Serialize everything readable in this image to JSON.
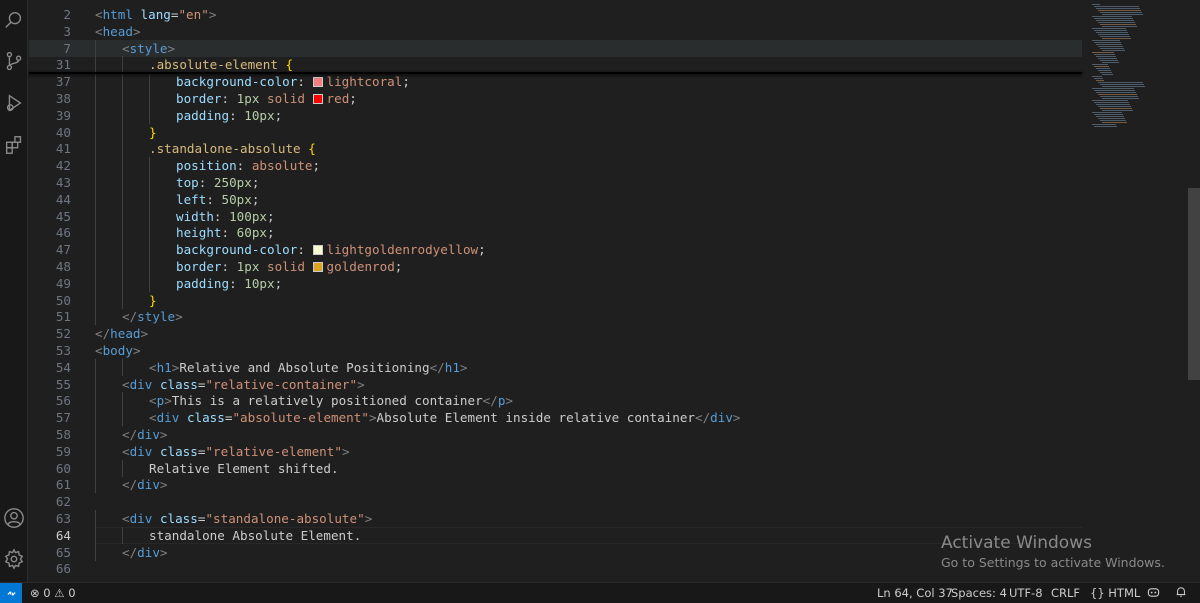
{
  "editor": {
    "lines": [
      {
        "num": "2",
        "indent": 0,
        "tokens": [
          [
            "t",
            "<"
          ],
          [
            "tg",
            "html"
          ],
          [
            "tx",
            " "
          ],
          [
            "at",
            "lang"
          ],
          [
            "tx",
            "="
          ],
          [
            "st",
            "\"en\""
          ],
          [
            "t",
            ">"
          ]
        ]
      },
      {
        "num": "3",
        "indent": 0,
        "tokens": [
          [
            "t",
            "<"
          ],
          [
            "tg",
            "head"
          ],
          [
            "t",
            ">"
          ]
        ]
      },
      {
        "num": "7",
        "indent": 1,
        "tokens": [
          [
            "t",
            "<"
          ],
          [
            "tg",
            "style"
          ],
          [
            "t",
            ">"
          ]
        ]
      },
      {
        "num": "31",
        "indent": 2,
        "tokens": [
          [
            "sel",
            ".absolute-element"
          ],
          [
            "tx",
            " "
          ],
          [
            "br",
            "{"
          ]
        ]
      },
      {
        "num": "37",
        "indent": 3,
        "tokens": [
          [
            "pr",
            "background-color"
          ],
          [
            "tx",
            ": "
          ],
          [
            "sw",
            "#f08080"
          ],
          [
            "vl",
            "lightcoral"
          ],
          [
            "tx",
            ";"
          ]
        ]
      },
      {
        "num": "38",
        "indent": 3,
        "tokens": [
          [
            "pr",
            "border"
          ],
          [
            "tx",
            ": "
          ],
          [
            "nm",
            "1px"
          ],
          [
            "tx",
            " "
          ],
          [
            "vl",
            "solid"
          ],
          [
            "tx",
            " "
          ],
          [
            "sw",
            "#ff0000"
          ],
          [
            "vl",
            "red"
          ],
          [
            "tx",
            ";"
          ]
        ]
      },
      {
        "num": "39",
        "indent": 3,
        "tokens": [
          [
            "pr",
            "padding"
          ],
          [
            "tx",
            ": "
          ],
          [
            "nm",
            "10px"
          ],
          [
            "tx",
            ";"
          ]
        ]
      },
      {
        "num": "40",
        "indent": 2,
        "tokens": [
          [
            "br",
            "}"
          ]
        ]
      },
      {
        "num": "41",
        "indent": 2,
        "tokens": [
          [
            "sel",
            ".standalone-absolute"
          ],
          [
            "tx",
            " "
          ],
          [
            "br",
            "{"
          ]
        ]
      },
      {
        "num": "42",
        "indent": 3,
        "tokens": [
          [
            "pr",
            "position"
          ],
          [
            "tx",
            ": "
          ],
          [
            "vl",
            "absolute"
          ],
          [
            "tx",
            ";"
          ]
        ]
      },
      {
        "num": "43",
        "indent": 3,
        "tokens": [
          [
            "pr",
            "top"
          ],
          [
            "tx",
            ": "
          ],
          [
            "nm",
            "250px"
          ],
          [
            "tx",
            ";"
          ]
        ]
      },
      {
        "num": "44",
        "indent": 3,
        "tokens": [
          [
            "pr",
            "left"
          ],
          [
            "tx",
            ": "
          ],
          [
            "nm",
            "50px"
          ],
          [
            "tx",
            ";"
          ]
        ]
      },
      {
        "num": "45",
        "indent": 3,
        "tokens": [
          [
            "pr",
            "width"
          ],
          [
            "tx",
            ": "
          ],
          [
            "nm",
            "100px"
          ],
          [
            "tx",
            ";"
          ]
        ]
      },
      {
        "num": "46",
        "indent": 3,
        "tokens": [
          [
            "pr",
            "height"
          ],
          [
            "tx",
            ": "
          ],
          [
            "nm",
            "60px"
          ],
          [
            "tx",
            ";"
          ]
        ]
      },
      {
        "num": "47",
        "indent": 3,
        "tokens": [
          [
            "pr",
            "background-color"
          ],
          [
            "tx",
            ": "
          ],
          [
            "sw",
            "#fafad2"
          ],
          [
            "vl",
            "lightgoldenrodyellow"
          ],
          [
            "tx",
            ";"
          ]
        ]
      },
      {
        "num": "48",
        "indent": 3,
        "tokens": [
          [
            "pr",
            "border"
          ],
          [
            "tx",
            ": "
          ],
          [
            "nm",
            "1px"
          ],
          [
            "tx",
            " "
          ],
          [
            "vl",
            "solid"
          ],
          [
            "tx",
            " "
          ],
          [
            "sw",
            "#daa520"
          ],
          [
            "vl",
            "goldenrod"
          ],
          [
            "tx",
            ";"
          ]
        ]
      },
      {
        "num": "49",
        "indent": 3,
        "tokens": [
          [
            "pr",
            "padding"
          ],
          [
            "tx",
            ": "
          ],
          [
            "nm",
            "10px"
          ],
          [
            "tx",
            ";"
          ]
        ]
      },
      {
        "num": "50",
        "indent": 2,
        "tokens": [
          [
            "br",
            "}"
          ]
        ]
      },
      {
        "num": "51",
        "indent": 1,
        "tokens": [
          [
            "t",
            "</"
          ],
          [
            "tg",
            "style"
          ],
          [
            "t",
            ">"
          ]
        ]
      },
      {
        "num": "52",
        "indent": 0,
        "tokens": [
          [
            "t",
            "</"
          ],
          [
            "tg",
            "head"
          ],
          [
            "t",
            ">"
          ]
        ]
      },
      {
        "num": "53",
        "indent": 0,
        "tokens": [
          [
            "t",
            "<"
          ],
          [
            "tg",
            "body"
          ],
          [
            "t",
            ">"
          ]
        ]
      },
      {
        "num": "54",
        "indent": 2,
        "tokens": [
          [
            "t",
            "<"
          ],
          [
            "tg",
            "h1"
          ],
          [
            "t",
            ">"
          ],
          [
            "tx",
            "Relative and Absolute Positioning"
          ],
          [
            "t",
            "</"
          ],
          [
            "tg",
            "h1"
          ],
          [
            "t",
            ">"
          ]
        ]
      },
      {
        "num": "55",
        "indent": 1,
        "tokens": [
          [
            "t",
            "<"
          ],
          [
            "tg",
            "div"
          ],
          [
            "tx",
            " "
          ],
          [
            "at",
            "class"
          ],
          [
            "tx",
            "="
          ],
          [
            "st",
            "\"relative-container\""
          ],
          [
            "t",
            ">"
          ]
        ]
      },
      {
        "num": "56",
        "indent": 2,
        "tokens": [
          [
            "t",
            "<"
          ],
          [
            "tg",
            "p"
          ],
          [
            "t",
            ">"
          ],
          [
            "tx",
            "This is a relatively positioned container"
          ],
          [
            "t",
            "</"
          ],
          [
            "tg",
            "p"
          ],
          [
            "t",
            ">"
          ]
        ]
      },
      {
        "num": "57",
        "indent": 2,
        "tokens": [
          [
            "t",
            "<"
          ],
          [
            "tg",
            "div"
          ],
          [
            "tx",
            " "
          ],
          [
            "at",
            "class"
          ],
          [
            "tx",
            "="
          ],
          [
            "st",
            "\"absolute-element\""
          ],
          [
            "t",
            ">"
          ],
          [
            "tx",
            "Absolute Element inside relative container"
          ],
          [
            "t",
            "</"
          ],
          [
            "tg",
            "div"
          ],
          [
            "t",
            ">"
          ]
        ]
      },
      {
        "num": "58",
        "indent": 1,
        "tokens": [
          [
            "t",
            "</"
          ],
          [
            "tg",
            "div"
          ],
          [
            "t",
            ">"
          ]
        ]
      },
      {
        "num": "59",
        "indent": 1,
        "tokens": [
          [
            "t",
            "<"
          ],
          [
            "tg",
            "div"
          ],
          [
            "tx",
            " "
          ],
          [
            "at",
            "class"
          ],
          [
            "tx",
            "="
          ],
          [
            "st",
            "\"relative-element\""
          ],
          [
            "t",
            ">"
          ]
        ]
      },
      {
        "num": "60",
        "indent": 2,
        "tokens": [
          [
            "tx",
            "Relative Element shifted."
          ]
        ]
      },
      {
        "num": "61",
        "indent": 1,
        "tokens": [
          [
            "t",
            "</"
          ],
          [
            "tg",
            "div"
          ],
          [
            "t",
            ">"
          ]
        ]
      },
      {
        "num": "62",
        "indent": 0,
        "tokens": []
      },
      {
        "num": "63",
        "indent": 1,
        "tokens": [
          [
            "t",
            "<"
          ],
          [
            "tg",
            "div"
          ],
          [
            "tx",
            " "
          ],
          [
            "at",
            "class"
          ],
          [
            "tx",
            "="
          ],
          [
            "st",
            "\"standalone-absolute\""
          ],
          [
            "t",
            ">"
          ]
        ]
      },
      {
        "num": "64",
        "indent": 2,
        "tokens": [
          [
            "tx",
            "standalone Absolute Element."
          ]
        ]
      },
      {
        "num": "65",
        "indent": 1,
        "tokens": [
          [
            "t",
            "</"
          ],
          [
            "tg",
            "div"
          ],
          [
            "t",
            ">"
          ]
        ]
      },
      {
        "num": "66",
        "indent": 0,
        "tokens": []
      }
    ],
    "active_line": "64"
  },
  "activity_bar": {
    "icons": [
      "explorer-search-icon",
      "source-control-icon",
      "run-debug-icon",
      "extensions-icon",
      "account-icon",
      "settings-gear-icon"
    ]
  },
  "watermark": {
    "title": "Activate Windows",
    "subtitle": "Go to Settings to activate Windows."
  },
  "status_bar": {
    "remote_icon": "remote-icon",
    "problems": "⊗ 0 ⚠ 0",
    "cursor": "Ln 64, Col 37",
    "spaces": "Spaces: 4",
    "encoding": "UTF-8",
    "eol": "CRLF",
    "language": "{} HTML",
    "copilot_icon": "copilot-icon",
    "bell_icon": "bell-icon"
  },
  "colors": {
    "accent": "#0078d4",
    "editor_bg": "#1f1f1f",
    "status_bg": "#181818"
  }
}
